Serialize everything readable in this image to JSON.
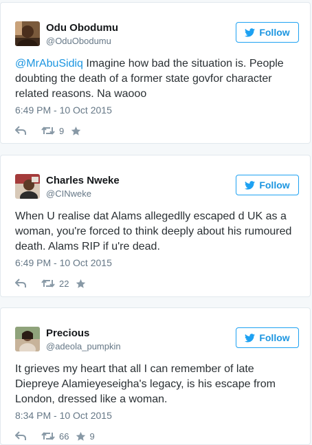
{
  "tweets": [
    {
      "name": "Odu Obodumu",
      "handle": "@OduObodumu",
      "follow_label": "Follow",
      "mention": "@MrAbuSidiq",
      "text": " Imagine how bad the situation is. People doubting the death of a former state govfor character related reasons. Na waooo",
      "time": "6:49 PM - 10 Oct 2015",
      "retweets": "9",
      "likes": ""
    },
    {
      "name": "Charles Nweke",
      "handle": "@CINweke",
      "follow_label": "Follow",
      "mention": "",
      "text": "When U realise dat Alams allegedlly escaped d UK as a woman, you're forced to think deeply about his rumoured death. Alams RIP if u're dead.",
      "time": "6:49 PM - 10 Oct 2015",
      "retweets": "22",
      "likes": ""
    },
    {
      "name": "Precious",
      "handle": "@adeola_pumpkin",
      "follow_label": "Follow",
      "mention": "",
      "text": "It grieves my heart that all I can remember of late Diepreye Alamieyeseigha's legacy, is his escape from London, dressed like a woman.",
      "time": "8:34 PM - 10 Oct 2015",
      "retweets": "66",
      "likes": "9"
    }
  ],
  "colors": {
    "accent": "#1da1f2",
    "link": "#1b95e0",
    "muted": "#657786",
    "icon": "#8899a6",
    "border": "#e1e8ed",
    "background": "#f5f8fa"
  },
  "icons": {
    "follow": "bird-icon",
    "reply": "reply-icon",
    "retweet": "retweet-icon",
    "like": "star-icon"
  }
}
